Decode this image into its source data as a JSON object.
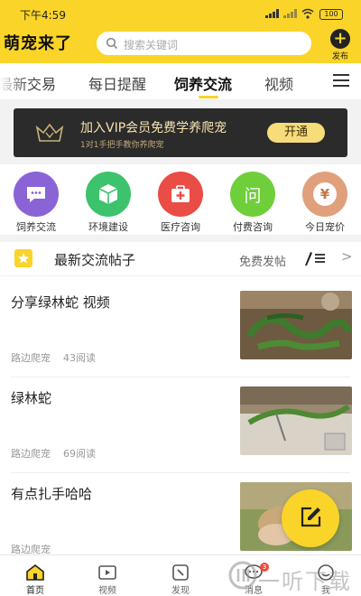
{
  "status_bar": {
    "time": "下午4:59",
    "battery": "100"
  },
  "header": {
    "logo_text": "萌宠来了",
    "search_placeholder": "搜索关键词",
    "post_label": "发布"
  },
  "tabs": [
    {
      "label": "最新交易"
    },
    {
      "label": "每日提醒"
    },
    {
      "label": "饲养交流",
      "active": true
    },
    {
      "label": "视频"
    }
  ],
  "vip_banner": {
    "title": "加入VIP会员免费学养爬宠",
    "subtitle": "1对1手把手教你养爬宠",
    "button": "开通"
  },
  "categories": [
    {
      "label": "饲养交流",
      "icon": "chat-icon",
      "color": "#8a63d6"
    },
    {
      "label": "环境建设",
      "icon": "cube-icon",
      "color": "#3cc36b"
    },
    {
      "label": "医疗咨询",
      "icon": "medical-kit-icon",
      "color": "#ea4c46"
    },
    {
      "label": "付费咨询",
      "icon": "question-icon",
      "glyph": "问",
      "color": "#6fcf3a"
    },
    {
      "label": "今日宠价",
      "icon": "price-icon",
      "glyph": "¥",
      "color": "#e0a07c"
    }
  ],
  "section": {
    "title": "最新交流帖子",
    "free_post": "免费发帖"
  },
  "posts": [
    {
      "title": "分享绿林蛇 视频",
      "author": "路边爬宠",
      "reads": "43阅读"
    },
    {
      "title": "绿林蛇",
      "author": "路边爬宠",
      "reads": "69阅读"
    },
    {
      "title": "有点扎手哈哈",
      "author": "路边爬宠",
      "reads": ""
    }
  ],
  "bottom_nav": [
    {
      "label": "首页",
      "icon": "home-icon",
      "active": true
    },
    {
      "label": "视频",
      "icon": "video-icon"
    },
    {
      "label": "发现",
      "icon": "discover-icon"
    },
    {
      "label": "消息",
      "icon": "message-icon",
      "badge": "3"
    },
    {
      "label": "我",
      "icon": "profile-icon"
    }
  ],
  "watermark": "一听下载",
  "colors": {
    "brand_yellow": "#fad428",
    "banner_dark": "#2b2b2b",
    "badge_red": "#f0493b"
  }
}
